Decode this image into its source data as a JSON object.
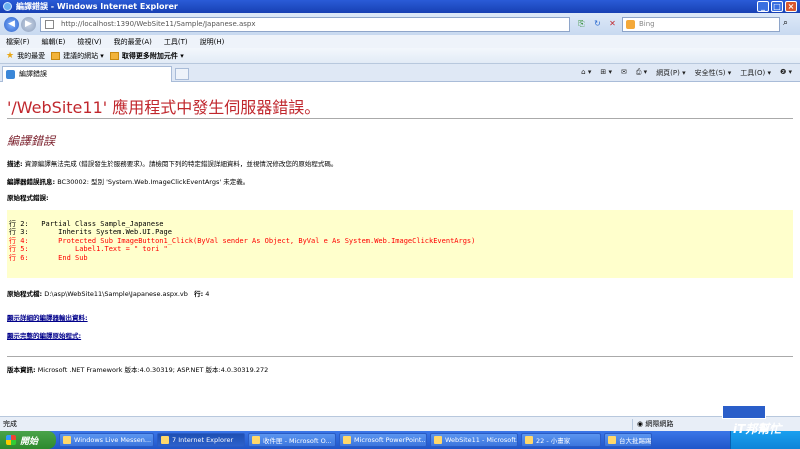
{
  "window": {
    "title": "編譯錯誤 - Windows Internet Explorer",
    "controls": [
      "_",
      "□",
      "×"
    ]
  },
  "address": {
    "url": "http://localhost:1390/WebSite11/Sample/Japanese.aspx",
    "search_placeholder": "Bing"
  },
  "menu": [
    "檔案(F)",
    "編輯(E)",
    "檢視(V)",
    "我的最愛(A)",
    "工具(T)",
    "說明(H)"
  ],
  "favorites": {
    "label": "我的最愛",
    "suggested": "建議的網站 ▾",
    "addons": "取得更多附加元件 ▾"
  },
  "tab": {
    "label": "編譯錯誤"
  },
  "command_bar": [
    "網頁(P) ▾",
    "安全性(S) ▾",
    "工具(O) ▾",
    "❷ ▾"
  ],
  "page": {
    "title": "'/WebSite11' 應用程式中發生伺服器錯誤。",
    "subtitle": "編譯錯誤",
    "description_label": "描述:",
    "description": "資源編譯無法完成 (錯誤發生於服務要求)。請檢閱下列的特定錯誤詳細資料，並視情況修改您的原始程式碼。",
    "compiler_msg_label": "編譯器錯誤訊息:",
    "compiler_msg": "BC30002: 型別 'System.Web.ImageClickEventArgs' 未定義。",
    "source_error_label": "原始程式錯誤:",
    "code_lines": [
      {
        "text": "行 2:   Partial Class Sample_Japanese",
        "error": false
      },
      {
        "text": "行 3:       Inherits System.Web.UI.Page",
        "error": false
      },
      {
        "text": "行 4:       Protected Sub ImageButton1_Click(ByVal sender As Object, ByVal e As System.Web.ImageClickEventArgs)",
        "error": true
      },
      {
        "text": "行 5:           Label1.Text = \" tori \"",
        "error": false
      },
      {
        "text": "行 6:       End Sub",
        "error": false
      }
    ],
    "source_file_label": "原始程式檔:",
    "source_file": "D:\\asp\\WebSite11\\Sample\\Japanese.aspx.vb",
    "line_label": "行:",
    "line_value": "4",
    "link1": "顯示詳細的編譯器輸出資料:",
    "link2": "顯示完整的編譯原始程式:",
    "version_label": "版本資訊:",
    "version": "Microsoft .NET Framework 版本:4.0.30319; ASP.NET 版本:4.0.30319.272"
  },
  "status": {
    "text": "完成",
    "zone": "網際網路"
  },
  "taskbar": {
    "start": "開始",
    "tasks": [
      "Windows Live Messen...",
      "7 Internet Explorer",
      "收件匣 - Microsoft O...",
      "Microsoft PowerPoint...",
      "WebSite11 - Microsoft...",
      "22 - 小畫家",
      "台大批踢踢實業坊 - ..."
    ]
  },
  "watermark": "iT邦幫忙"
}
